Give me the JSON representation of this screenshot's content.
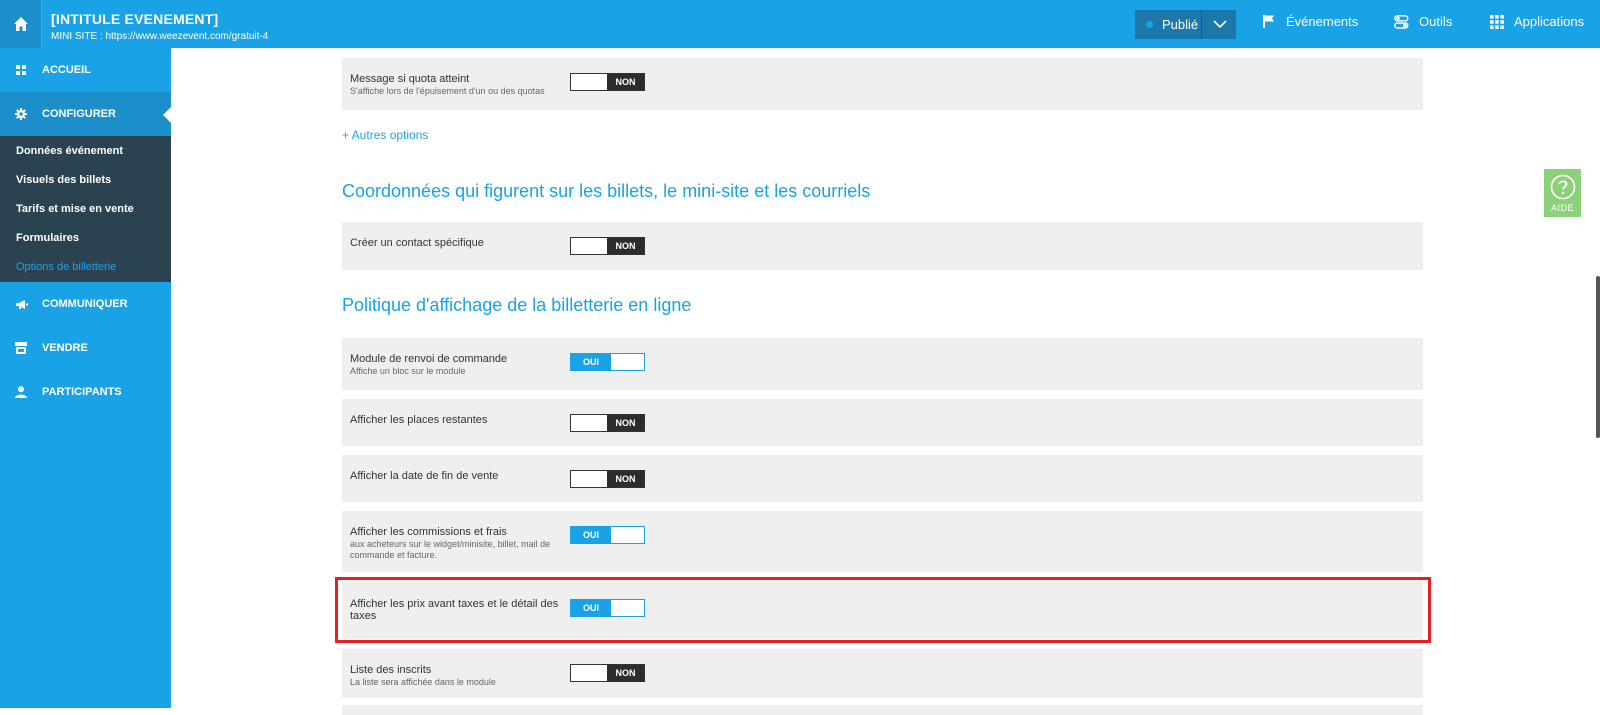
{
  "topbar": {
    "event_title": "[INTITULE EVENEMENT]",
    "mini_site_url": "MINI SITE : https://www.weezevent.com/gratuit-4",
    "status": "Publié",
    "nav": [
      {
        "label": "Événements",
        "icon": "flag-icon"
      },
      {
        "label": "Outils",
        "icon": "toggles-icon"
      },
      {
        "label": "Applications",
        "icon": "grid-icon"
      }
    ]
  },
  "sidebar": {
    "items": [
      {
        "label": "ACCUEIL",
        "icon": "dashboard-icon"
      },
      {
        "label": "CONFIGURER",
        "icon": "gear-icon"
      },
      {
        "label": "COMMUNIQUER",
        "icon": "megaphone-icon"
      },
      {
        "label": "VENDRE",
        "icon": "store-icon"
      },
      {
        "label": "PARTICIPANTS",
        "icon": "user-icon"
      }
    ],
    "submenu": [
      {
        "label": "Données événement"
      },
      {
        "label": "Visuels des billets"
      },
      {
        "label": "Tarifs et mise en vente"
      },
      {
        "label": "Formulaires"
      },
      {
        "label": "Options de billetterie"
      }
    ]
  },
  "main": {
    "quota_row": {
      "label": "Message si quota atteint",
      "hint": "S'affiche lors de l'épuisement d'un ou des quotas",
      "state": "NON"
    },
    "more_options": "+ Autres options",
    "section_contact": "Coordonnées qui figurent sur les billets, le mini-site et les courriels",
    "contact_row": {
      "label": "Créer un contact spécifique",
      "state": "NON"
    },
    "section_policy": "Politique d'affichage de la billetterie en ligne",
    "policy_rows": [
      {
        "label": "Module de renvoi de commande",
        "hint": "Affiche un bloc sur le module",
        "state": "OUI"
      },
      {
        "label": "Afficher les places restantes",
        "hint": "",
        "state": "NON"
      },
      {
        "label": "Afficher la date de fin de vente",
        "hint": "",
        "state": "NON"
      },
      {
        "label": "Afficher les commissions et frais",
        "hint": "aux acheteurs sur le widget/minisite, billet, mail de commande et facture.",
        "state": "OUI"
      },
      {
        "label": "Afficher les prix avant taxes et le détail des taxes",
        "hint": "",
        "state": "OUI"
      },
      {
        "label": "Liste des inscrits",
        "hint": "La liste sera affichée dans le module",
        "state": "NON"
      }
    ]
  },
  "help": {
    "label": "AIDE"
  },
  "colors": {
    "accent": "#1aa2e6",
    "sidebar_dark": "#2b4350",
    "highlight": "#e42020",
    "help": "#8dd07a"
  }
}
